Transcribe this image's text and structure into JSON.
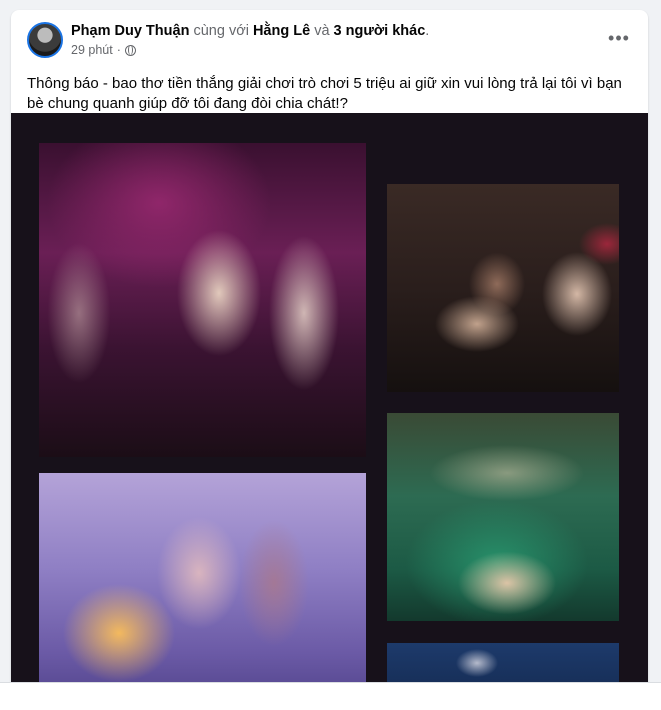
{
  "post": {
    "author": "Phạm Duy Thuận",
    "with_text": "cùng với",
    "tagged": "Hằng Lê",
    "and_text": "và",
    "others": "3 người khác",
    "period": ".",
    "time": "29 phút",
    "separator": "·",
    "privacy_icon": "globe-icon",
    "more_icon": "more-horizontal-icon",
    "more_label": "•••",
    "text": "Thông báo - bao thơ tiền thắng giải chơi trò chơi 5 triệu ai giữ xin vui lòng trả lại tôi vì bạn bè chung quanh giúp đỡ tôi đang đòi chia chát!?"
  },
  "colors": {
    "link": "#1b74e4",
    "muted": "#65676b",
    "text": "#050505",
    "photo_background": "#17111a",
    "page_background": "#f0f2f5"
  }
}
